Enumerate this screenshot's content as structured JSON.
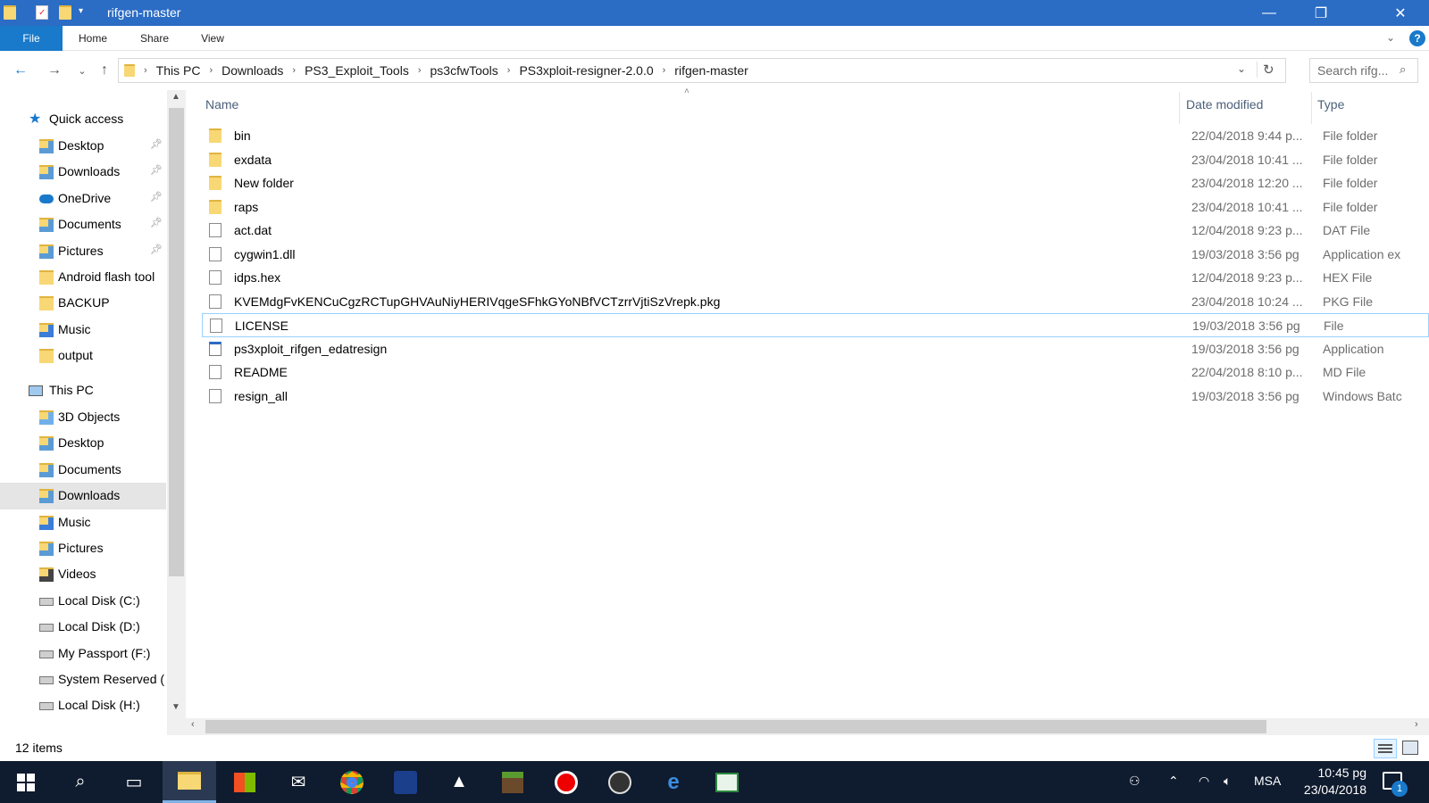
{
  "window": {
    "title": "rifgen-master",
    "controls": {
      "minimize": "—",
      "restore": "❐",
      "close": "✕"
    }
  },
  "ribbon": {
    "tabs": [
      "File",
      "Home",
      "Share",
      "View"
    ],
    "help_icon": "?"
  },
  "address": {
    "crumbs": [
      "This PC",
      "Downloads",
      "PS3_Exploit_Tools",
      "ps3cfwTools",
      "PS3xploit-resigner-2.0.0",
      "rifgen-master"
    ],
    "search_placeholder": "Search rifg..."
  },
  "sidebar": {
    "quick_access": "Quick access",
    "quick_items": [
      {
        "label": "Desktop",
        "pinned": true,
        "icon": "desktop-folder-icon"
      },
      {
        "label": "Downloads",
        "pinned": true,
        "icon": "downloads-folder-icon"
      },
      {
        "label": "OneDrive",
        "pinned": true,
        "icon": "onedrive-icon"
      },
      {
        "label": "Documents",
        "pinned": true,
        "icon": "documents-folder-icon"
      },
      {
        "label": "Pictures",
        "pinned": true,
        "icon": "pictures-folder-icon"
      },
      {
        "label": "Android flash tool",
        "pinned": false,
        "icon": "folder-icon"
      },
      {
        "label": "BACKUP",
        "pinned": false,
        "icon": "folder-icon"
      },
      {
        "label": "Music",
        "pinned": false,
        "icon": "music-folder-icon"
      },
      {
        "label": "output",
        "pinned": false,
        "icon": "folder-icon"
      }
    ],
    "this_pc": "This PC",
    "pc_items": [
      {
        "label": "3D Objects",
        "icon": "3d-objects-icon"
      },
      {
        "label": "Desktop",
        "icon": "desktop-folder-icon"
      },
      {
        "label": "Documents",
        "icon": "documents-folder-icon"
      },
      {
        "label": "Downloads",
        "icon": "downloads-folder-icon",
        "selected": true
      },
      {
        "label": "Music",
        "icon": "music-folder-icon"
      },
      {
        "label": "Pictures",
        "icon": "pictures-folder-icon"
      },
      {
        "label": "Videos",
        "icon": "videos-folder-icon"
      },
      {
        "label": "Local Disk (C:)",
        "icon": "drive-icon"
      },
      {
        "label": "Local Disk (D:)",
        "icon": "drive-icon"
      },
      {
        "label": "My Passport (F:)",
        "icon": "drive-icon"
      },
      {
        "label": "System Reserved (",
        "icon": "drive-icon"
      },
      {
        "label": "Local Disk (H:)",
        "icon": "drive-icon"
      }
    ]
  },
  "columns": {
    "name": "Name",
    "date": "Date modified",
    "type": "Type"
  },
  "files": [
    {
      "name": "bin",
      "date": "22/04/2018 9:44 p...",
      "type": "File folder",
      "kind": "folder"
    },
    {
      "name": "exdata",
      "date": "23/04/2018 10:41 ...",
      "type": "File folder",
      "kind": "folder"
    },
    {
      "name": "New folder",
      "date": "23/04/2018 12:20 ...",
      "type": "File folder",
      "kind": "folder"
    },
    {
      "name": "raps",
      "date": "23/04/2018 10:41 ...",
      "type": "File folder",
      "kind": "folder"
    },
    {
      "name": "act.dat",
      "date": "12/04/2018 9:23 p...",
      "type": "DAT File",
      "kind": "doc"
    },
    {
      "name": "cygwin1.dll",
      "date": "19/03/2018 3:56 pg",
      "type": "Application ex",
      "kind": "doc"
    },
    {
      "name": "idps.hex",
      "date": "12/04/2018 9:23 p...",
      "type": "HEX File",
      "kind": "doc"
    },
    {
      "name": "KVEMdgFvKENCuCgzRCTupGHVAuNiyHERIVqgeSFhkGYoNBfVCTzrrVjtiSzVrepk.pkg",
      "date": "23/04/2018 10:24 ...",
      "type": "PKG File",
      "kind": "doc"
    },
    {
      "name": "LICENSE",
      "date": "19/03/2018 3:56 pg",
      "type": "File",
      "kind": "doc",
      "focused": true
    },
    {
      "name": "ps3xploit_rifgen_edatresign",
      "date": "19/03/2018 3:56 pg",
      "type": "Application",
      "kind": "app"
    },
    {
      "name": "README",
      "date": "22/04/2018 8:10 p...",
      "type": "MD File",
      "kind": "doc"
    },
    {
      "name": "resign_all",
      "date": "19/03/2018 3:56 pg",
      "type": "Windows Batc",
      "kind": "doc"
    }
  ],
  "status": {
    "count": "12 items"
  },
  "taskbar": {
    "lang": "MSA",
    "time": "10:45 pg",
    "date": "23/04/2018",
    "notification_count": "1"
  },
  "colors": {
    "accent": "#2b6cc4",
    "file_tab": "#1979ca",
    "taskbar": "#0f1b2e"
  }
}
